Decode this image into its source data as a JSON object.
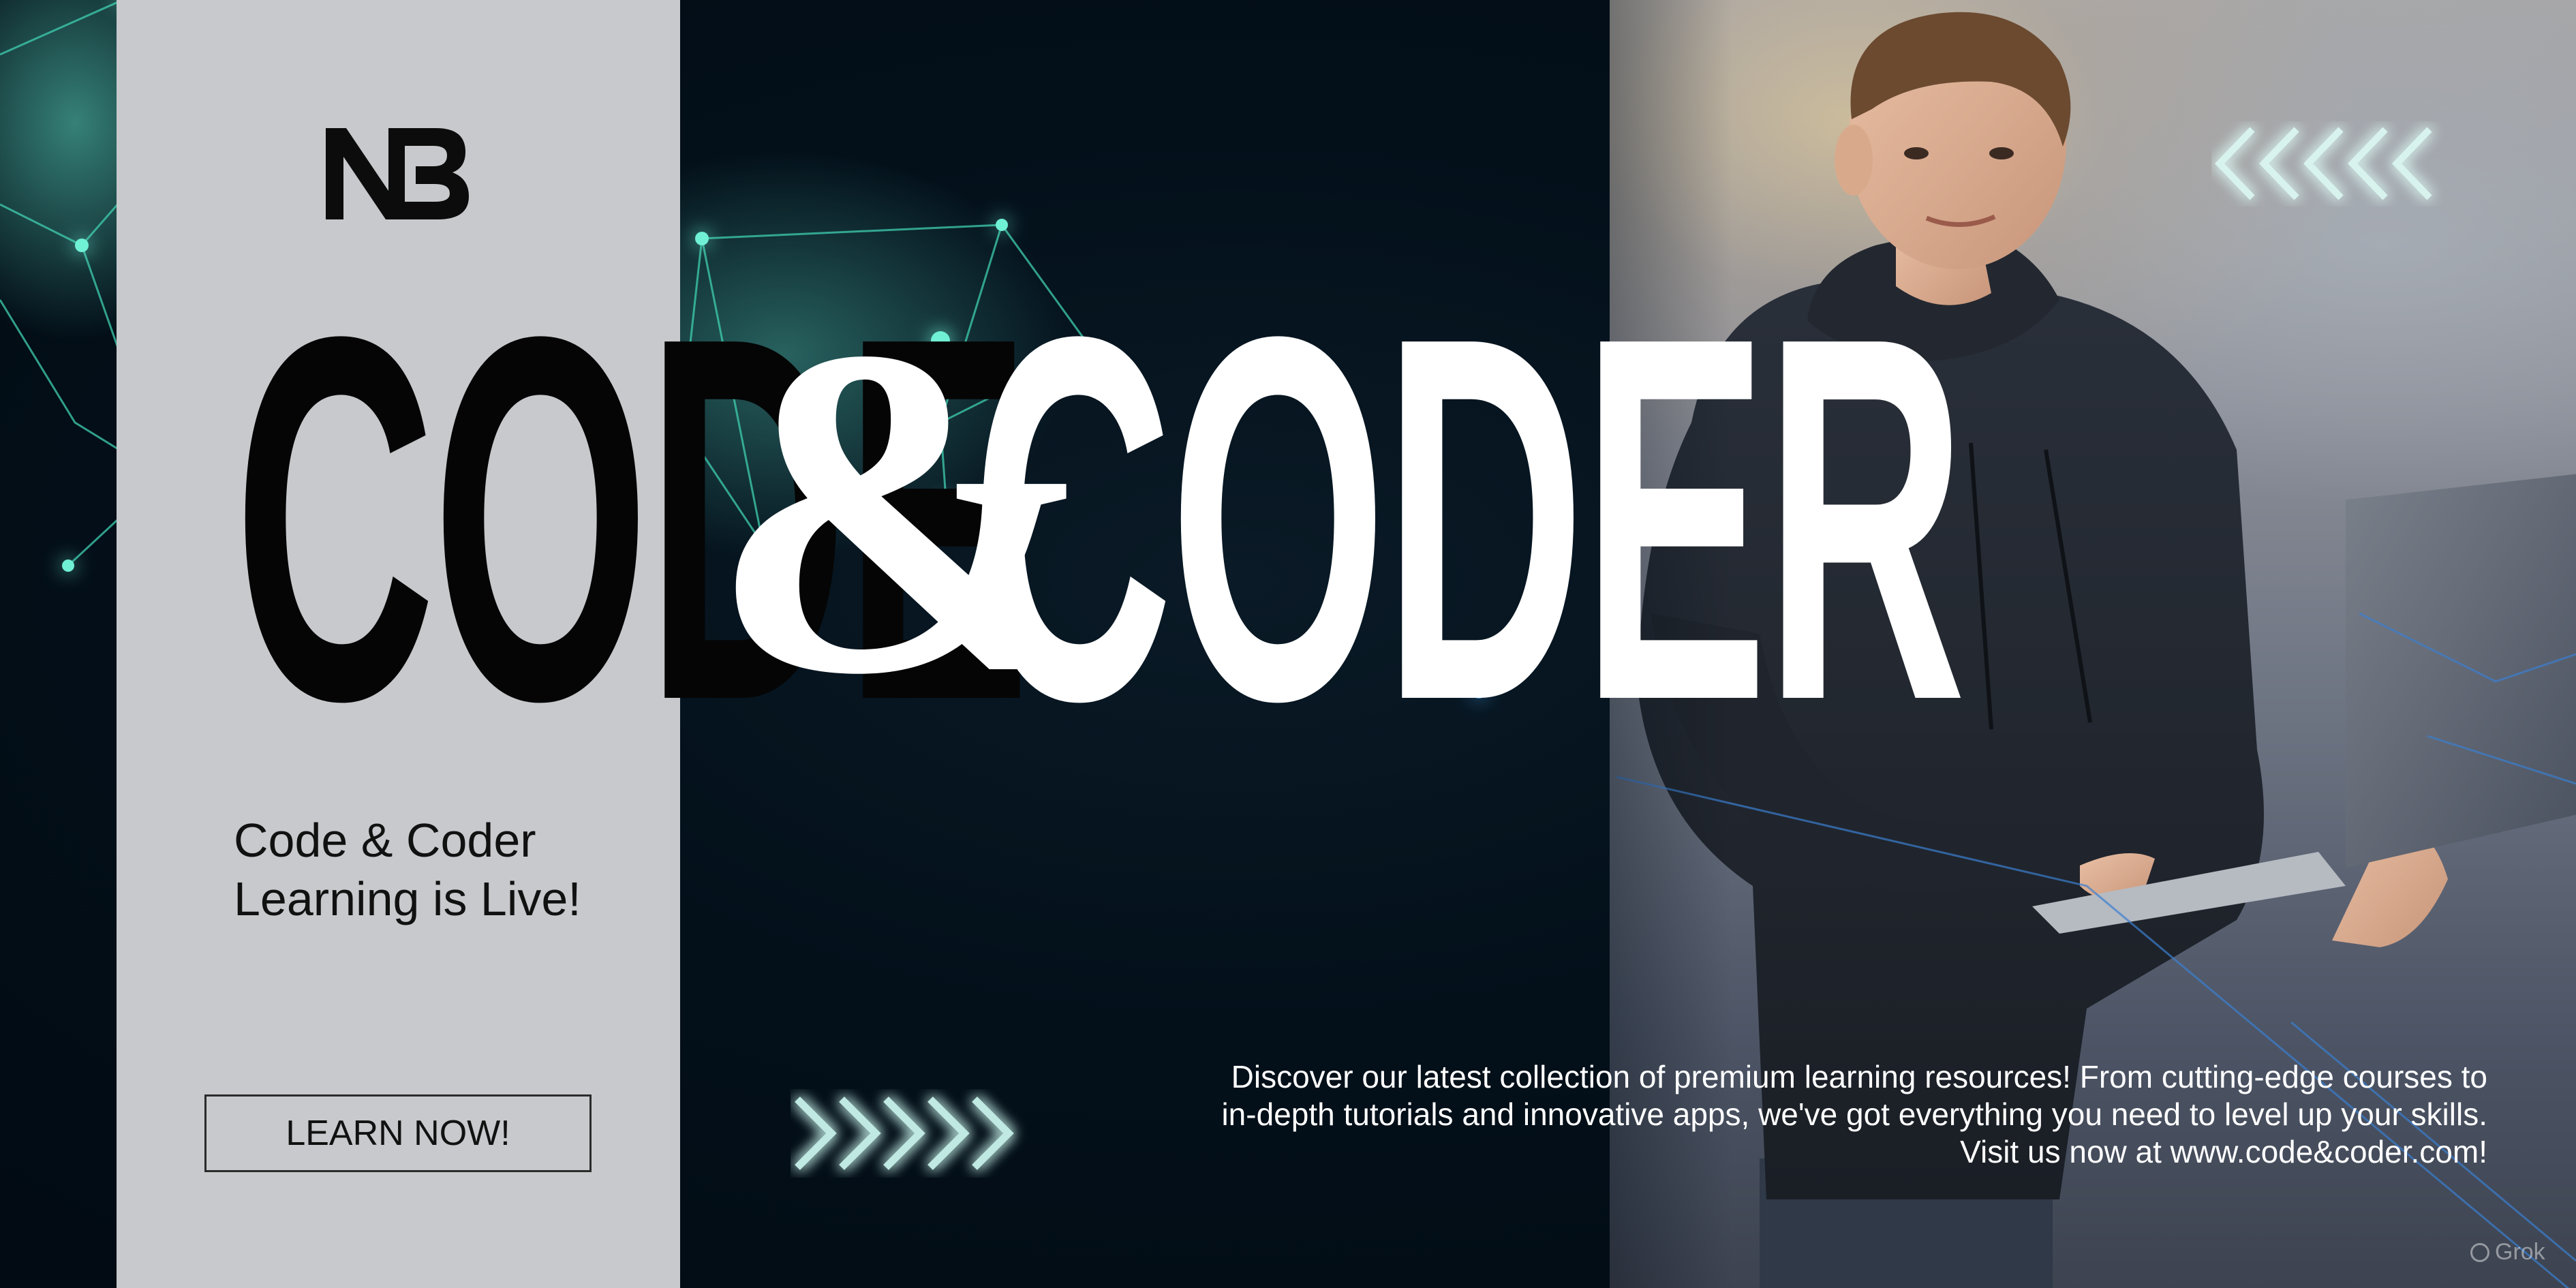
{
  "brand": {
    "logo_text": "NB"
  },
  "headline": {
    "word_one": "CODE",
    "ampersand": "&",
    "word_two": "CODER"
  },
  "tagline": {
    "text": "Code & Coder Learning is Live!"
  },
  "cta": {
    "label": "LEARN NOW!"
  },
  "description": {
    "text": "Discover our latest collection of premium learning resources! From cutting-edge courses to in-depth tutorials and innovative apps, we've got everything you need to level up your skills. Visit us now at www.code&coder.com!"
  },
  "watermark": {
    "text": "Grok"
  },
  "icons": {
    "logo": "nb-monogram-icon",
    "chevrons_right": "chevrons-right-icon",
    "chevrons_left": "chevrons-left-icon",
    "watermark": "grok-icon"
  },
  "colors": {
    "background": "#040d16",
    "panel": "#c7c9cc",
    "accent": "#7fe3d0",
    "title_dark": "#050505",
    "title_light": "#ffffff"
  }
}
